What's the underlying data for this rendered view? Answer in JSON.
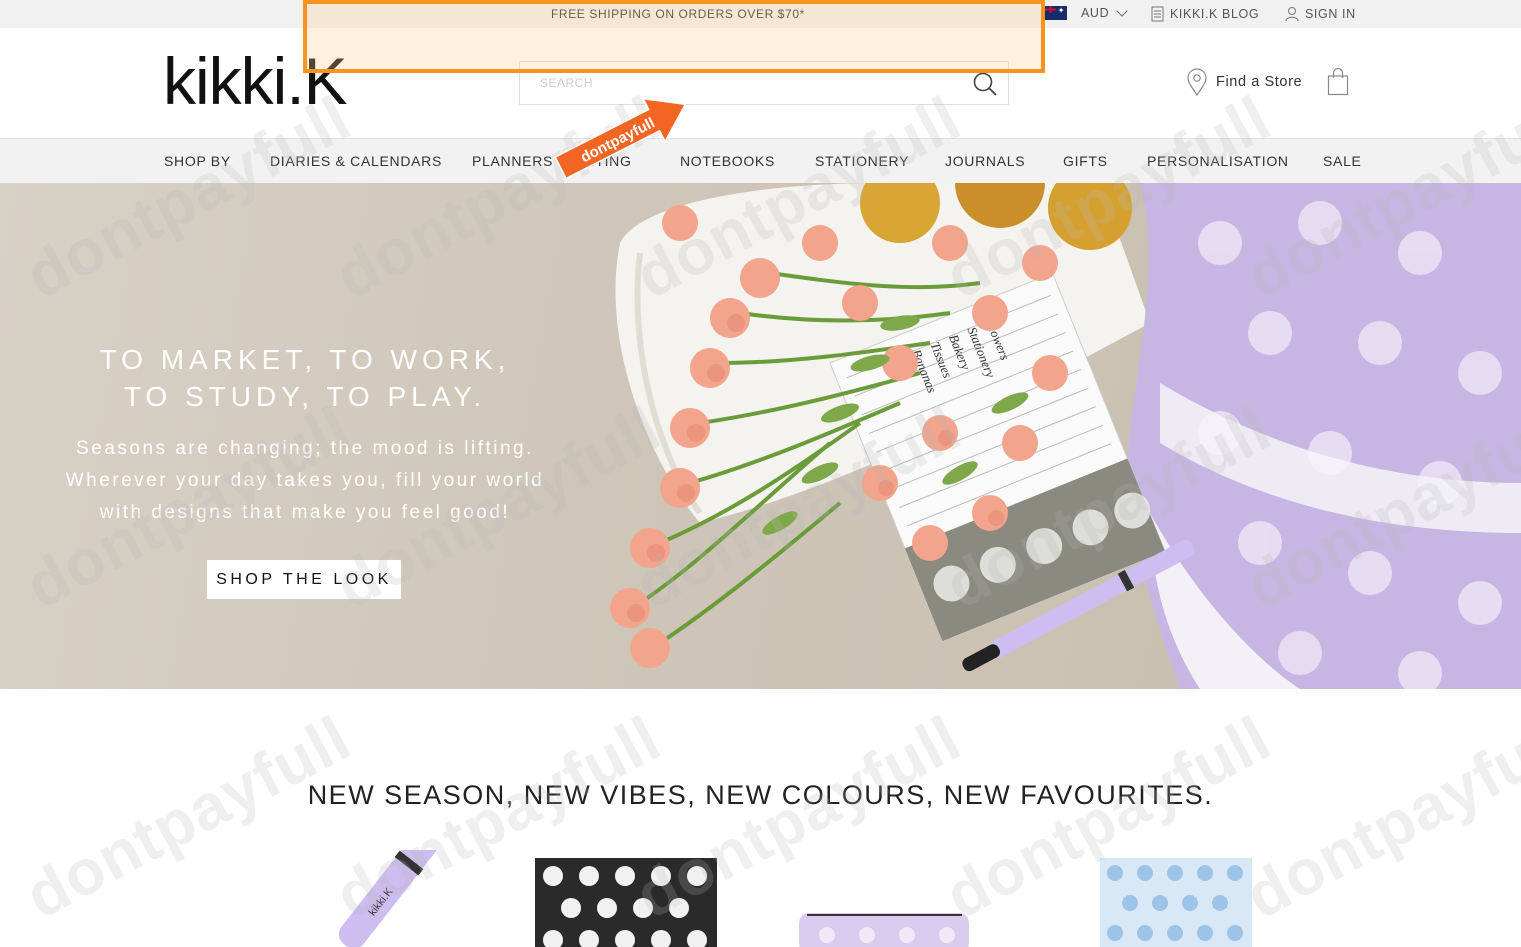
{
  "topbar": {
    "promo": "FREE SHIPPING ON ORDERS OVER $70*",
    "currency": "AUD",
    "blog": "KIKKI.K BLOG",
    "sign_in": "SIGN IN"
  },
  "header": {
    "logo": "kikki.K",
    "search_placeholder": "SEARCH",
    "find_store": "Find a Store"
  },
  "nav": {
    "items": [
      {
        "label": "SHOP BY"
      },
      {
        "label": "DIARIES & CALENDARS"
      },
      {
        "label": "PLANNERS"
      },
      {
        "label": "WRITING"
      },
      {
        "label": "NOTEBOOKS"
      },
      {
        "label": "STATIONERY"
      },
      {
        "label": "JOURNALS"
      },
      {
        "label": "GIFTS"
      },
      {
        "label": "PERSONALISATION"
      },
      {
        "label": "SALE"
      }
    ]
  },
  "hero": {
    "headline_1": "TO MARKET, TO WORK,",
    "headline_2": "TO STUDY, TO PLAY.",
    "sub_1": "Seasons are changing; the mood is lifting.",
    "sub_2": "Wherever your day takes you, fill your world",
    "sub_3": "with designs that make you feel good!",
    "cta": "SHOP THE LOOK"
  },
  "section": {
    "title": "NEW SEASON, NEW VIBES, NEW COLOURS, NEW FAVOURITES."
  },
  "overlay": {
    "callout": "dontpayfull",
    "watermark": "dontpayfull",
    "highlight_color": "#f7941d"
  },
  "product_labels": {
    "pen": "kikki.K"
  },
  "notepad": {
    "line1": "Flowers",
    "line2": "Stationery",
    "line3": "Bakery",
    "line4": "Tissues",
    "line5": "Bananas"
  }
}
